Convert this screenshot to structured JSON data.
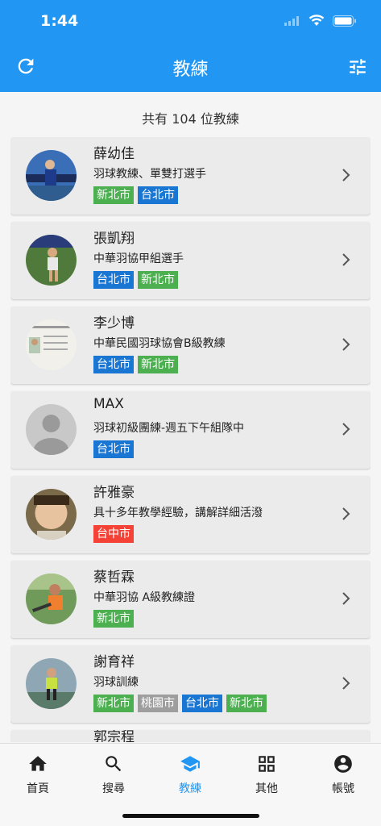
{
  "status_bar": {
    "time": "1:44"
  },
  "header": {
    "title": "教練"
  },
  "summary": {
    "count_text": "共有 104 位教練"
  },
  "colors": {
    "primary": "#2196f3",
    "tag_green": "#4caf50",
    "tag_blue": "#1976d2",
    "tag_red": "#f44336",
    "tag_grey": "#9e9e9e"
  },
  "coaches": [
    {
      "name": "薛幼佳",
      "desc": "羽球教練、單雙打選手",
      "tags": [
        {
          "label": "新北市",
          "color": "green"
        },
        {
          "label": "台北市",
          "color": "blue"
        }
      ]
    },
    {
      "name": "張凱翔",
      "desc": "中華羽協甲組選手",
      "tags": [
        {
          "label": "台北市",
          "color": "blue"
        },
        {
          "label": "新北市",
          "color": "green"
        }
      ]
    },
    {
      "name": "李少博",
      "desc": "中華民國羽球協會B級教練",
      "tags": [
        {
          "label": "台北市",
          "color": "blue"
        },
        {
          "label": "新北市",
          "color": "green"
        }
      ]
    },
    {
      "name": "MAX",
      "desc": "羽球初級團練-週五下午組隊中",
      "tags": [
        {
          "label": "台北市",
          "color": "blue"
        }
      ]
    },
    {
      "name": "許雅豪",
      "desc": "具十多年教學經驗，講解詳細活潑",
      "tags": [
        {
          "label": "台中市",
          "color": "red"
        }
      ]
    },
    {
      "name": "蔡哲霖",
      "desc": "中華羽協 A級教練證",
      "tags": [
        {
          "label": "新北市",
          "color": "green"
        }
      ]
    },
    {
      "name": "謝育祥",
      "desc": "羽球訓練",
      "tags": [
        {
          "label": "新北市",
          "color": "green"
        },
        {
          "label": "桃園市",
          "color": "grey"
        },
        {
          "label": "台北市",
          "color": "blue"
        },
        {
          "label": "新北市",
          "color": "green"
        }
      ]
    }
  ],
  "partial_next_name": "郭宗程",
  "tabs": [
    {
      "label": "首頁",
      "icon": "home-icon",
      "active": false
    },
    {
      "label": "搜尋",
      "icon": "search-icon",
      "active": false
    },
    {
      "label": "教練",
      "icon": "school-icon",
      "active": true
    },
    {
      "label": "其他",
      "icon": "grid-icon",
      "active": false
    },
    {
      "label": "帳號",
      "icon": "account-icon",
      "active": false
    }
  ]
}
